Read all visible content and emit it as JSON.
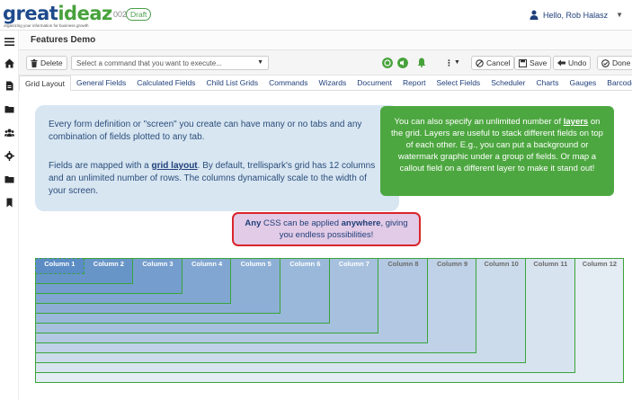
{
  "header": {
    "logo_part1": "great",
    "logo_part2": "ideaz",
    "logo_tagline": "organizing your information for business growth",
    "doc_number": "002",
    "status": "Draft",
    "user_greeting": "Hello, Rob Halasz"
  },
  "rail": {
    "items": [
      "menu-icon",
      "home-icon",
      "document-icon",
      "folder-icon",
      "users-icon",
      "gear-icon",
      "folder-icon",
      "bookmark-icon"
    ]
  },
  "page": {
    "title": "Features Demo"
  },
  "toolbar": {
    "delete_label": "Delete",
    "command_placeholder": "Select a command that you want to execute...",
    "cancel_label": "Cancel",
    "save_label": "Save",
    "undo_label": "Undo",
    "done_label": "Done"
  },
  "tabs": [
    {
      "label": "Grid Layout",
      "active": true
    },
    {
      "label": "General Fields"
    },
    {
      "label": "Calculated Fields"
    },
    {
      "label": "Child List Grids"
    },
    {
      "label": "Commands"
    },
    {
      "label": "Wizards"
    },
    {
      "label": "Document"
    },
    {
      "label": "Report"
    },
    {
      "label": "Select Fields"
    },
    {
      "label": "Scheduler"
    },
    {
      "label": "Charts"
    },
    {
      "label": "Gauges"
    },
    {
      "label": "Barcodes"
    }
  ],
  "info": {
    "p1": "Every form definition or \"screen\" you create can have many or no tabs and any combination of fields plotted to any tab.",
    "p2_before": "Fields are mapped with a ",
    "p2_link": "grid layout",
    "p2_after": ". By default, trellispark's grid has 12 columns and an unlimited number of rows. The columns dynamically scale to the width of your screen."
  },
  "layers_note": {
    "before": "You can also specify an unlimited number of ",
    "link": "layers",
    "after": " on the grid. Layers are useful to stack different fields on top of each other. E.g., you can put a background or watermark graphic under a group of fields. Or map a callout field on a different layer to make it stand out!"
  },
  "css_note": {
    "w1": "Any",
    "mid": " CSS can be applied ",
    "w2": "anywhere",
    "end": ", giving you endless possibilities!"
  },
  "grid": {
    "columns": [
      "Column 1",
      "Column 2",
      "Column 3",
      "Column 4",
      "Column 5",
      "Column 6",
      "Column 7",
      "Column 8",
      "Column 9",
      "Column 10",
      "Column 11",
      "Column 12"
    ]
  },
  "colors": {
    "brand_blue": "#1f4a8c",
    "brand_green": "#48a23c",
    "callout_green": "#4da740",
    "info_bg": "#d8e6f2",
    "css_border": "#d9252b"
  }
}
